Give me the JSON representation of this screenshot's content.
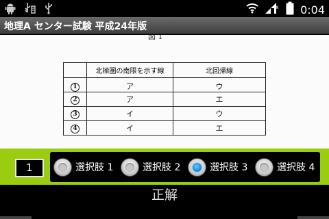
{
  "status_bar": {
    "time": "0:04",
    "left_icons": [
      "android-icon",
      "usb-debug-icon",
      "usb-icon"
    ],
    "right_icons": [
      "wifi-icon",
      "signal-icon",
      "battery-icon"
    ]
  },
  "app": {
    "title": "地理A センター試験 平成24年版"
  },
  "scan": {
    "figure_label": "図 1",
    "table": {
      "headers": [
        "",
        "北極圏の南限を示す線",
        "北回帰線"
      ],
      "rows": [
        {
          "num": "1",
          "a": "ア",
          "b": "ウ"
        },
        {
          "num": "2",
          "a": "ア",
          "b": "エ"
        },
        {
          "num": "3",
          "a": "イ",
          "b": "ウ"
        },
        {
          "num": "4",
          "a": "イ",
          "b": "エ"
        }
      ]
    }
  },
  "answer_panel": {
    "question_number": "1",
    "choices": [
      {
        "label": "選択肢 1",
        "checked": false
      },
      {
        "label": "選択肢 2",
        "checked": false
      },
      {
        "label": "選択肢 3",
        "checked": true
      },
      {
        "label": "選択肢 4",
        "checked": false
      }
    ],
    "accent_color": "#9acd0f"
  },
  "bottom": {
    "correct_label": "正解"
  }
}
